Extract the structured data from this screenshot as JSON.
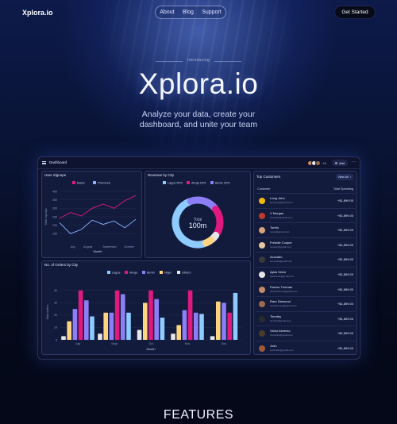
{
  "nav": {
    "logo": "Xplora.io",
    "links": [
      "About",
      "Blog",
      "Support"
    ],
    "cta": "Get Started"
  },
  "hero": {
    "eyebrow": "Introducing",
    "title": "Xplora.io",
    "subtitle_lines": [
      "Analyze your data, create your",
      "dashboard, and unite your team"
    ]
  },
  "dashboard": {
    "title": "Dashboard",
    "extra_members": "+4",
    "add_label": "Add",
    "more_label": "···",
    "user_signups": {
      "title": "User Signups",
      "legend": [
        "Basic",
        "Premium"
      ]
    },
    "revenue": {
      "title": "Revenue by City",
      "total_label": "Total",
      "total_value": "100m"
    },
    "orders": {
      "title": "No. of Orders by City"
    },
    "customers": {
      "title": "Top Customers",
      "view_all": "View All",
      "col_customer": "Customer",
      "col_spending": "Total Spending",
      "rows": [
        {
          "name": "Long John",
          "email": "jonnyboy@gmail.com",
          "amount": "+$1,899.00",
          "color": "#f2b705"
        },
        {
          "name": "V Morgan",
          "email": "vmorgan@gmail.com",
          "amount": "+$1,899.00",
          "color": "#c0392b"
        },
        {
          "name": "Toreto",
          "email": "toreto@gmail.com",
          "amount": "+$1,899.00",
          "color": "#d8a27a"
        },
        {
          "name": "Freddie Cooper",
          "email": "fcooper@gmail.com",
          "amount": "+$1,899.00",
          "color": "#e8c8a0"
        },
        {
          "name": "Avocado",
          "email": "avocado@gmail.com",
          "amount": "+$1,899.00",
          "color": "#3a3a3a"
        },
        {
          "name": "Ajala Victor",
          "email": "ajalavictor@gmail.com",
          "amount": "+$1,899.00",
          "color": "#e6e6e6"
        },
        {
          "name": "Favour Thomas",
          "email": "favourthomas@gmail.com",
          "amount": "+$1,899.00",
          "color": "#c48a6a"
        },
        {
          "name": "Rare Diamond",
          "email": "rarediamond@gmail.com",
          "amount": "+$1,899.00",
          "color": "#9a6b4f"
        },
        {
          "name": "Timothy",
          "email": "timothy@gmail.com",
          "amount": "+$1,899.00",
          "color": "#2b2b2b"
        },
        {
          "name": "Victor Almenlo",
          "email": "vlamenlo@gmail.com",
          "amount": "+$1,899.00",
          "color": "#4a3a2a"
        },
        {
          "name": "Josh",
          "email": "joshmiller@gmail.com",
          "amount": "+$1,899.00",
          "color": "#a05a3a"
        }
      ]
    }
  },
  "features_heading": "FEATURES",
  "chart_data": [
    {
      "type": "line",
      "title": "User Signups",
      "xlabel": "Month",
      "ylabel": "Total signups",
      "categories": [
        "July",
        "August",
        "September",
        "October"
      ],
      "x": [
        0,
        0.5,
        1,
        1.5,
        2,
        2.5,
        3,
        3.5
      ],
      "ylim": [
        100,
        400
      ],
      "yticks": [
        150,
        200,
        250,
        300,
        350,
        400
      ],
      "series": [
        {
          "name": "Basic",
          "color": "#e0197e",
          "values": [
            240,
            275,
            255,
            300,
            325,
            300,
            345,
            375
          ]
        },
        {
          "name": "Premium",
          "color": "#8ab4ff",
          "values": [
            215,
            150,
            175,
            230,
            205,
            225,
            185,
            235
          ]
        }
      ]
    },
    {
      "type": "pie",
      "title": "Revenue by City",
      "labels": [
        "Lagos",
        "Abuja",
        "Benin",
        "Niger",
        "Others"
      ],
      "legend_labels": [
        "Lagos 50%",
        "Abuja 20%",
        "Benin 20%"
      ],
      "values": [
        50,
        20,
        20,
        5,
        5
      ],
      "colors": [
        "#8ecbff",
        "#e0197e",
        "#8c7ff5",
        "#ffd480",
        "#e6e6e6"
      ]
    },
    {
      "type": "bar",
      "title": "No. of Orders by City",
      "xlabel": "Month",
      "ylabel": "Total orders",
      "categories": [
        "July",
        "Sept",
        "Oct",
        "Nov",
        "Dec"
      ],
      "ylim": [
        0,
        45
      ],
      "yticks": [
        0,
        10,
        20,
        30,
        40
      ],
      "series": [
        {
          "name": "Lagos",
          "color": "#8ecbff",
          "values": [
            2,
            2,
            2,
            2,
            2
          ]
        },
        {
          "name": "Abuja",
          "color": "#e0197e",
          "values": [
            19,
            22,
            13,
            10,
            33
          ]
        },
        {
          "name": "Benin",
          "color": "#8c7ff5",
          "values": [
            25,
            26,
            21,
            16,
            23
          ]
        },
        {
          "name": "Niger",
          "color": "#ffd480",
          "values": [
            15,
            12,
            31,
            29,
            24
          ]
        },
        {
          "name": "Others",
          "color": "#e6e6e6",
          "values": [
            6,
            5,
            8,
            6,
            5
          ]
        }
      ],
      "bars_per_group": [
        [
          [
            "Others",
            3
          ],
          [
            "Niger",
            15
          ],
          [
            "Benin",
            25
          ],
          [
            "Abuja",
            40
          ],
          [
            "Benin",
            32
          ],
          [
            "Lagos",
            19
          ]
        ],
        [
          [
            "Others",
            5
          ],
          [
            "Niger",
            22
          ],
          [
            "Benin",
            22
          ],
          [
            "Abuja",
            40
          ],
          [
            "Benin",
            37
          ],
          [
            "Lagos",
            22
          ]
        ],
        [
          [
            "Others",
            8
          ],
          [
            "Niger",
            30
          ],
          [
            "Abuja",
            40
          ],
          [
            "Benin",
            33
          ],
          [
            "Lagos",
            18
          ],
          [
            "Lagos",
            0
          ]
        ],
        [
          [
            "Others",
            5
          ],
          [
            "Niger",
            12
          ],
          [
            "Benin",
            24
          ],
          [
            "Abuja",
            40
          ],
          [
            "Benin",
            22
          ],
          [
            "Lagos",
            21
          ]
        ],
        [
          [
            "Others",
            3
          ],
          [
            "Niger",
            31
          ],
          [
            "Benin",
            30
          ],
          [
            "Abuja",
            22
          ],
          [
            "Lagos",
            38
          ],
          [
            "Lagos",
            0
          ]
        ]
      ]
    }
  ]
}
